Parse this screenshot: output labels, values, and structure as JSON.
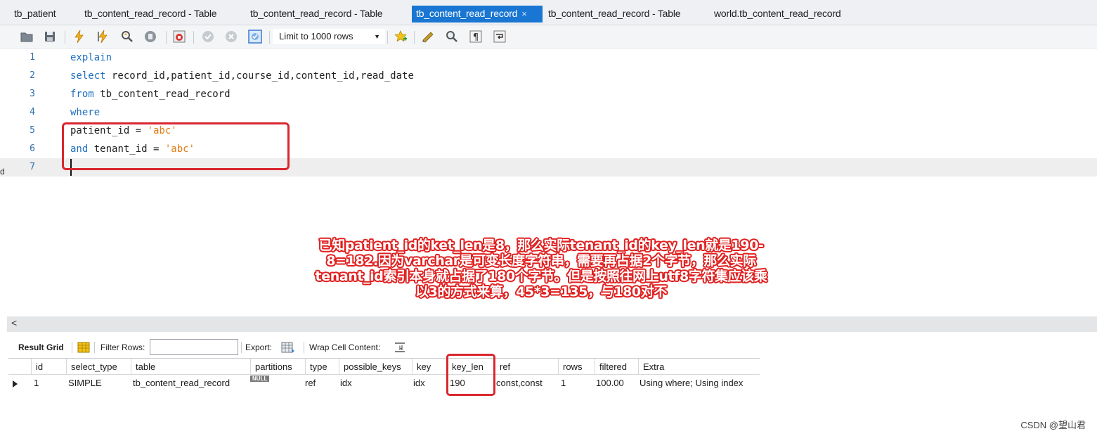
{
  "tabs": [
    {
      "label": "tb_patient",
      "active": false
    },
    {
      "label": "tb_content_read_record - Table",
      "active": false
    },
    {
      "label": "tb_content_read_record - Table",
      "active": false
    },
    {
      "label": "tb_content_read_record",
      "active": true,
      "close": "×"
    },
    {
      "label": "tb_content_read_record - Table",
      "active": false
    },
    {
      "label": "world.tb_content_read_record",
      "active": false
    }
  ],
  "toolbar": {
    "icons": [
      "open-folder-icon",
      "save-icon",
      "execute-icon",
      "execute-current-icon",
      "explain-icon",
      "stop-icon",
      "toggle-error-icon",
      "commit-icon",
      "rollback-icon",
      "autocommit-icon",
      "bookmark-icon",
      "beautify-icon",
      "find-icon",
      "invisible-chars-icon",
      "wrap-icon"
    ],
    "limit_label": "Limit to 1000 rows"
  },
  "editor": {
    "lines": [
      {
        "num": "1",
        "tokens": [
          {
            "t": "explain",
            "k": "kw"
          }
        ]
      },
      {
        "num": "2",
        "tokens": [
          {
            "t": "select",
            "k": "kw"
          },
          {
            "t": " record_id,patient_id,course_id,content_id,read_date",
            "k": "id"
          }
        ]
      },
      {
        "num": "3",
        "tokens": [
          {
            "t": "from",
            "k": "kw"
          },
          {
            "t": " tb_content_read_record",
            "k": "id"
          }
        ]
      },
      {
        "num": "4",
        "tokens": [
          {
            "t": "where",
            "k": "kw"
          }
        ]
      },
      {
        "num": "5",
        "tokens": [
          {
            "t": "patient_id = ",
            "k": "id"
          },
          {
            "t": "'abc'",
            "k": "str"
          }
        ]
      },
      {
        "num": "6",
        "tokens": [
          {
            "t": "and",
            "k": "kw"
          },
          {
            "t": " tenant_id = ",
            "k": "id"
          },
          {
            "t": "'abc'",
            "k": "str"
          }
        ]
      },
      {
        "num": "7",
        "tokens": []
      }
    ],
    "left_stub": "d"
  },
  "annotation": {
    "text": "已知patient_id的ket_len是8，那么实际tenant_id的key_len就是190-8=182.因为varchar是可变长度字符串，需要再占据2个字节，那么实际tenant_id索引本身就占据了180个字节。但是按照往网上utf8字符集应该乘以3的方式来算，45*3=135，与180对不"
  },
  "scrollbar": {
    "arrow": "<"
  },
  "result_toolbar": {
    "result_grid": "Result Grid",
    "filter_rows": "Filter Rows:",
    "filter_value": "",
    "export": "Export:",
    "wrap_cell": "Wrap Cell Content:"
  },
  "grid": {
    "columns": [
      "id",
      "select_type",
      "table",
      "partitions",
      "type",
      "possible_keys",
      "key",
      "key_len",
      "ref",
      "rows",
      "filtered",
      "Extra"
    ],
    "rows": [
      [
        "1",
        "SIMPLE",
        "tb_content_read_record",
        "NULL",
        "ref",
        "idx",
        "idx",
        "190",
        "const,const",
        "1",
        "100.00",
        "Using where; Using index"
      ]
    ]
  },
  "watermark": "CSDN @望山君",
  "colors": {
    "accent": "#1976d2",
    "highlight": "#d9262f",
    "keyword": "#1f6fbf",
    "string": "#e07b12"
  }
}
